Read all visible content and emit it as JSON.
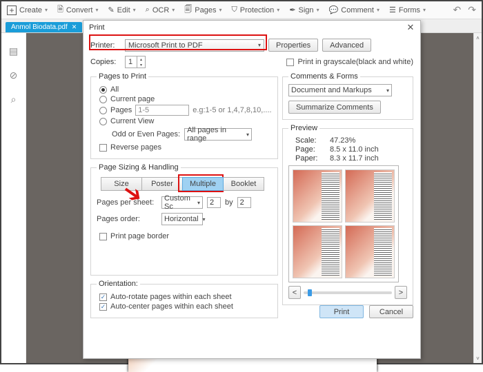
{
  "toolbar": {
    "create": "Create",
    "convert": "Convert",
    "edit": "Edit",
    "ocr": "OCR",
    "pages": "Pages",
    "protection": "Protection",
    "sign": "Sign",
    "comment": "Comment",
    "forms": "Forms"
  },
  "tab": {
    "name": "Anmol Biodata.pdf"
  },
  "dialog": {
    "title": "Print",
    "printer_label": "Printer:",
    "printer_value": "Microsoft Print to PDF",
    "properties": "Properties",
    "advanced": "Advanced",
    "copies_label": "Copies:",
    "copies_value": "1",
    "grayscale": "Print in grayscale(black and white)",
    "pages_to_print": {
      "legend": "Pages to Print",
      "all": "All",
      "current": "Current page",
      "pages": "Pages",
      "pages_value": "1-5",
      "pages_hint": "e.g:1-5 or 1,4,7,8,10,....",
      "current_view": "Current View",
      "odd_even_label": "Odd or Even Pages:",
      "odd_even_value": "All pages in range",
      "reverse": "Reverse pages"
    },
    "sizing": {
      "legend": "Page Sizing & Handling",
      "size": "Size",
      "poster": "Poster",
      "multiple": "Multiple",
      "booklet": "Booklet",
      "pps_label": "Pages per sheet:",
      "pps_value": "Custom Sc",
      "pps_cols": "2",
      "pps_by": "by",
      "pps_rows": "2",
      "order_label": "Pages order:",
      "order_value": "Horizontal",
      "border": "Print page border"
    },
    "comments": {
      "legend": "Comments & Forms",
      "value": "Document and Markups",
      "summarize": "Summarize Comments"
    },
    "preview": {
      "legend": "Preview",
      "scale_k": "Scale:",
      "scale_v": "47.23%",
      "doc_k": "Page:",
      "doc_v": "8.5 x 11.0 inch",
      "paper_k": "Paper:",
      "paper_v": "8.3 x 11.7 inch",
      "prev": "<",
      "next": ">"
    },
    "orientation": {
      "legend": "Orientation:",
      "auto_rotate": "Auto-rotate pages within each sheet",
      "auto_center": "Auto-center pages within each sheet"
    },
    "print": "Print",
    "cancel": "Cancel"
  }
}
